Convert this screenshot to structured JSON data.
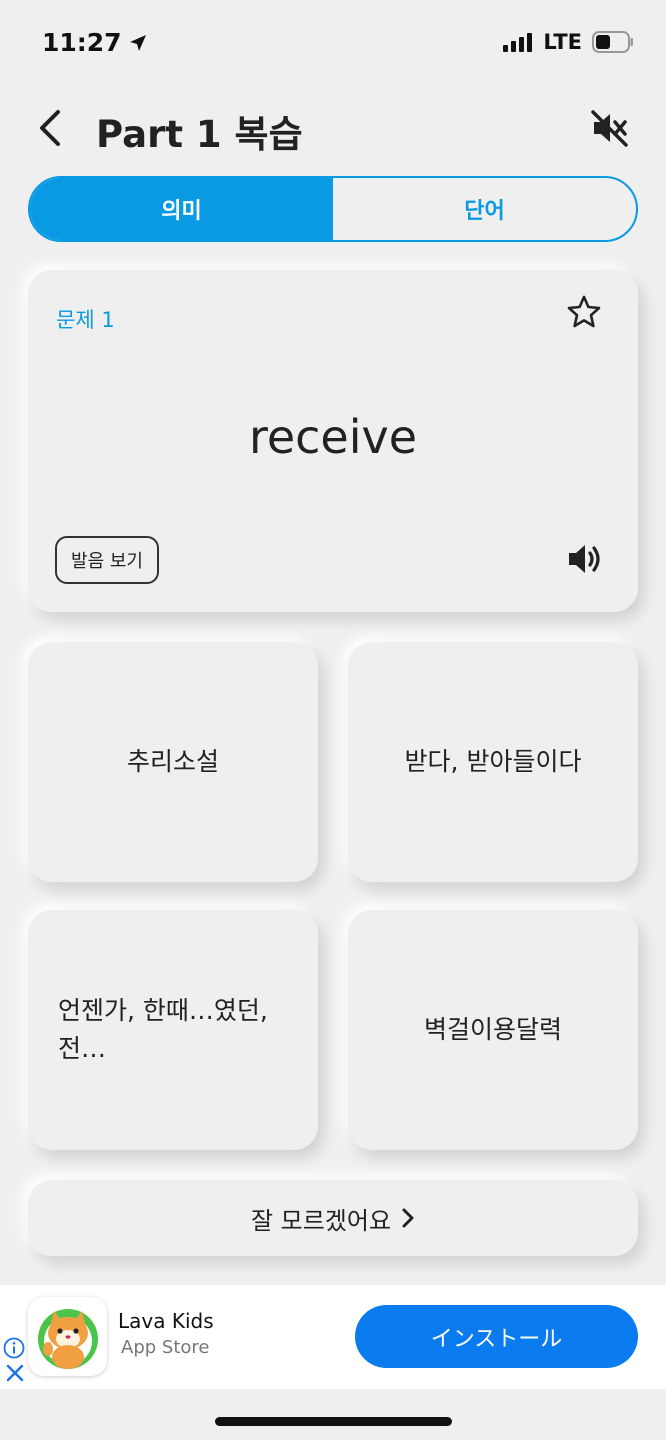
{
  "status_bar": {
    "time": "11:27",
    "network": "LTE"
  },
  "header": {
    "title": "Part 1 복습"
  },
  "tabs": [
    {
      "label": "의미",
      "active": true
    },
    {
      "label": "단어",
      "active": false
    }
  ],
  "question": {
    "label": "문제 1",
    "word": "receive",
    "pronunciation_button": "발음 보기"
  },
  "options": [
    {
      "text": "추리소설"
    },
    {
      "text": "받다, 받아들이다"
    },
    {
      "text": "언젠가, 한때…였던, 전…"
    },
    {
      "text": "벽걸이용달력"
    }
  ],
  "dont_know": {
    "label": "잘 모르겠어요"
  },
  "ad": {
    "app_name": "Lava Kids",
    "store": "App Store",
    "install_label": "インストール"
  },
  "colors": {
    "accent": "#0a9ae4",
    "install_blue": "#0a7cf0",
    "background": "#efefef"
  }
}
